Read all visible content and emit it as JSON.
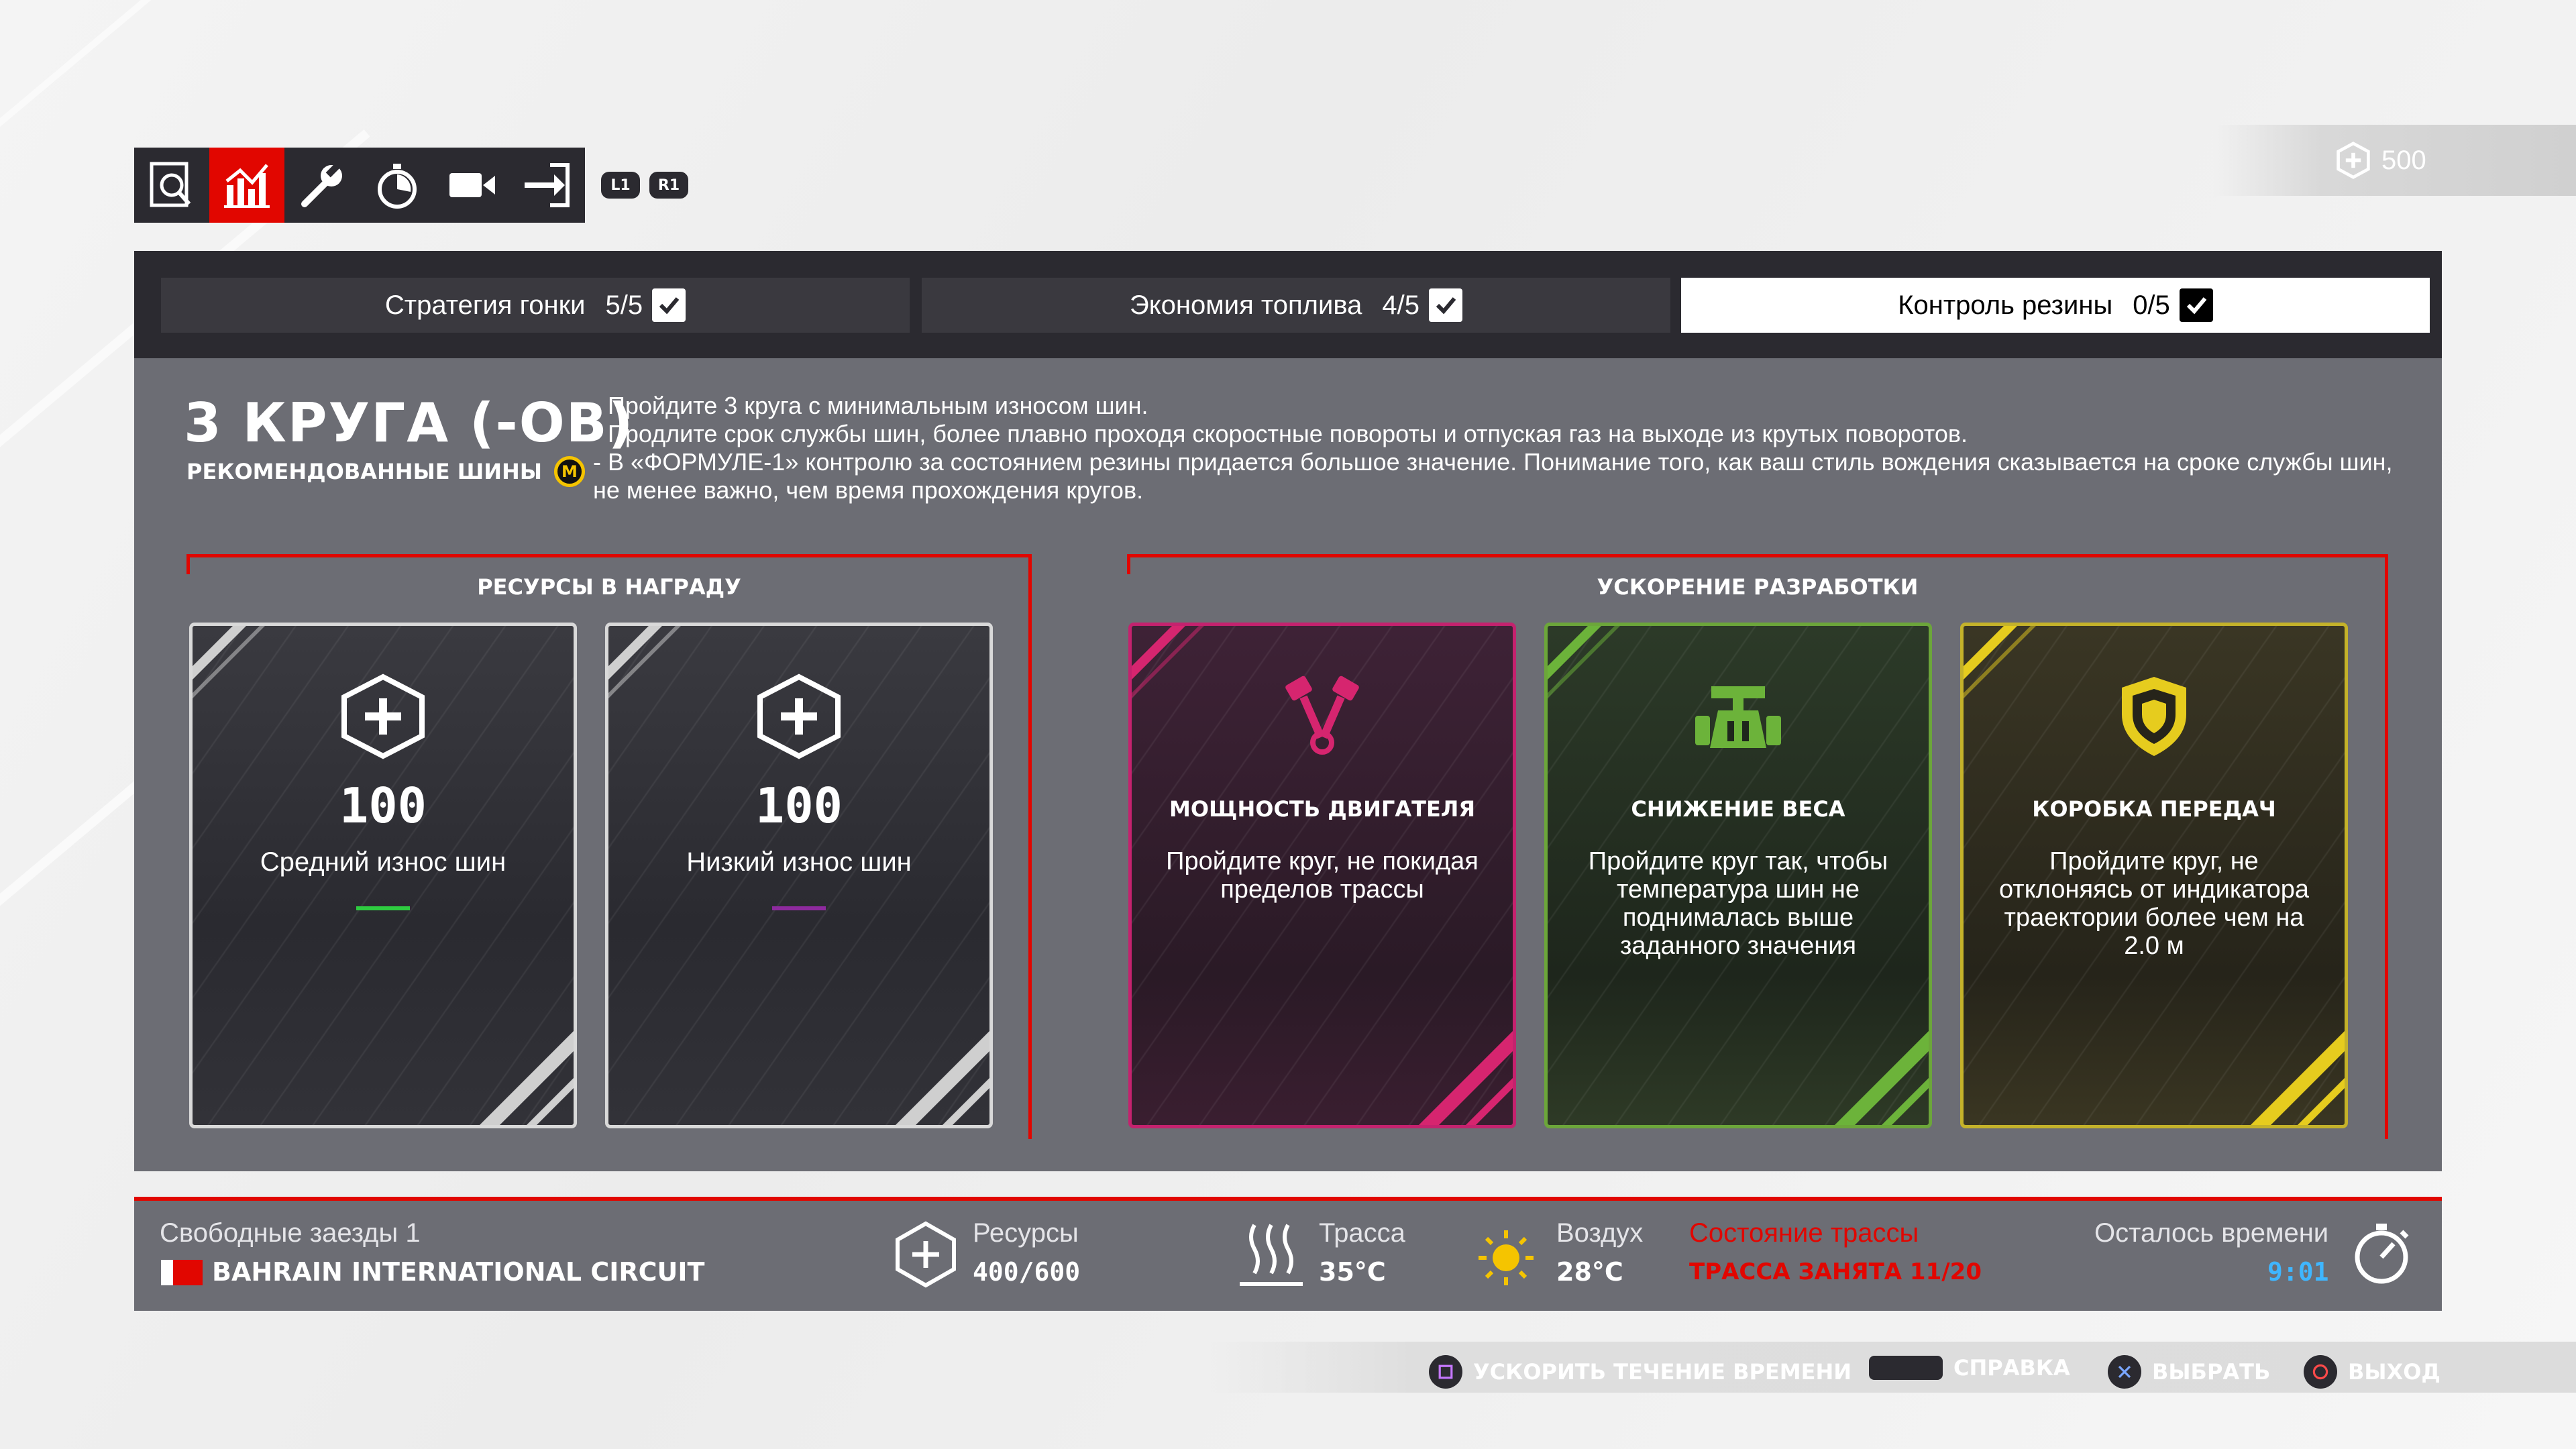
{
  "toolbar": {
    "items": [
      {
        "icon": "search-document-icon",
        "active": false
      },
      {
        "icon": "bar-chart-icon",
        "active": true
      },
      {
        "icon": "wrench-icon",
        "active": false
      },
      {
        "icon": "stopwatch-icon",
        "active": false
      },
      {
        "icon": "video-camera-icon",
        "active": false
      },
      {
        "icon": "exit-icon",
        "active": false
      }
    ],
    "l1_label": "L1",
    "r1_label": "R1"
  },
  "currency": {
    "icon": "resource-plus-icon",
    "value": "500"
  },
  "tabs": [
    {
      "label": "Стратегия гонки",
      "score": "5/5",
      "checked": true,
      "selected": false
    },
    {
      "label": "Экономия топлива",
      "score": "4/5",
      "checked": true,
      "selected": false
    },
    {
      "label": "Контроль резины",
      "score": "0/5",
      "checked": true,
      "selected": true
    }
  ],
  "program": {
    "laps_title": "3 КРУГА (-ОВ)",
    "recommended_label": "РЕКОМЕНДОВАННЫЕ ШИНЫ",
    "tire_compound": "M",
    "description": [
      "- Пройдите 3 круга с минимальным износом шин.",
      "- Продлите срок службы шин, более плавно проходя скоростные повороты и отпуская газ на выходе из крутых поворотов.",
      "- В «ФОРМУЛЕ-1» контролю за состоянием резины придается большое значение. Понимание того, как ваш стиль вождения сказывается на сроке службы шин, не менее важно, чем время прохождения кругов."
    ]
  },
  "rewards": {
    "title": "РЕСУРСЫ В НАГРАДУ",
    "cards": [
      {
        "amount": "100",
        "label": "Средний износ шин",
        "dash_color": "#2ecc40"
      },
      {
        "amount": "100",
        "label": "Низкий износ шин",
        "dash_color": "#8e2a9e"
      }
    ]
  },
  "development": {
    "title": "УСКОРЕНИЕ РАЗРАБОТКИ",
    "cards": [
      {
        "icon": "engine-pistons-icon",
        "title": "МОЩНОСТЬ ДВИГАТЕЛЯ",
        "text": "Пройдите круг, не покидая пределов трассы",
        "color": "#d6256f"
      },
      {
        "icon": "car-weight-icon",
        "title": "СНИЖЕНИЕ ВЕСА",
        "text": "Пройдите круг так, чтобы температура шин не поднималась выше заданного значения",
        "color": "#6cb33a"
      },
      {
        "icon": "gearbox-shield-icon",
        "title": "КОРОБКА ПЕРЕДАЧ",
        "text": "Пройдите круг, не отклоняясь от индикатора траектории более чем на 2.0 м",
        "color": "#e6cc1e"
      }
    ]
  },
  "status": {
    "session": "Свободные заезды 1",
    "circuit": "BAHRAIN INTERNATIONAL CIRCUIT",
    "resources_label": "Ресурсы",
    "resources_value": "400/600",
    "track_label": "Трасса",
    "track_value": "35°C",
    "air_label": "Воздух",
    "air_value": "28°C",
    "track_state_label": "Состояние трассы",
    "track_state_value": "ТРАССА ЗАНЯТА 11/20",
    "time_left_label": "Осталось времени",
    "time_left_value": "9:01",
    "colors": {
      "accent": "#e10600",
      "time": "#3fb6ff",
      "sun": "#f5c400"
    }
  },
  "hints": [
    {
      "icon": "square-button-icon",
      "label": "УСКОРИТЬ ТЕЧЕНИЕ ВРЕМЕНИ"
    },
    {
      "icon": "touchpad-icon",
      "label": "СПРАВКА"
    },
    {
      "icon": "cross-button-icon",
      "label": "ВЫБРАТЬ"
    },
    {
      "icon": "circle-button-icon",
      "label": "ВЫХОД"
    }
  ]
}
